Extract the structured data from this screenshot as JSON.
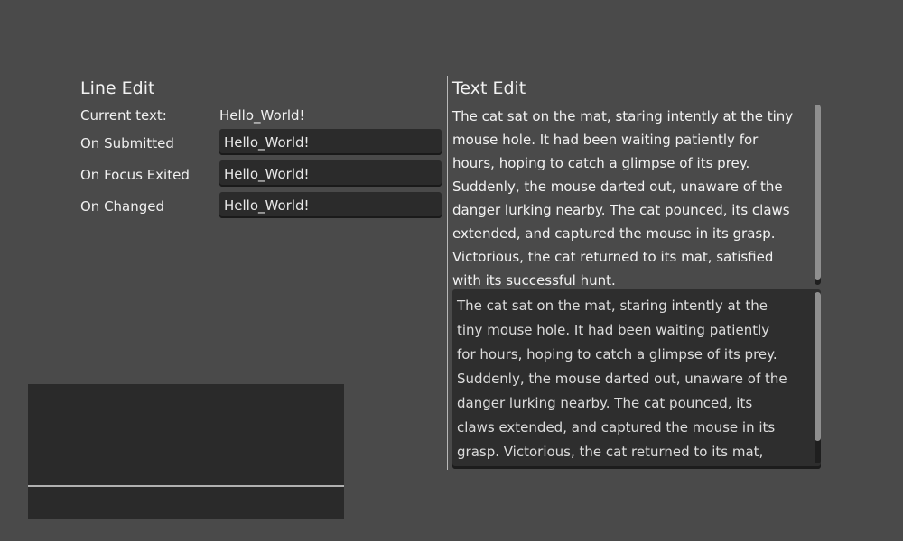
{
  "line_edit": {
    "title": "Line Edit",
    "current_text_label": "Current text:",
    "current_text_value": "Hello_World!",
    "rows": [
      {
        "label": "On Submitted",
        "value": "Hello_World!"
      },
      {
        "label": "On Focus Exited",
        "value": "Hello_World!"
      },
      {
        "label": "On Changed",
        "value": "Hello_World!"
      }
    ]
  },
  "text_edit": {
    "title": "Text Edit",
    "display_text": "The cat sat on the mat, staring intently at the tiny\nmouse hole. It had been waiting patiently for\nhours, hoping to catch a glimpse of its prey.\nSuddenly, the mouse darted out, unaware of the\ndanger lurking nearby. The cat pounced, its claws\nextended, and captured the mouse in its grasp.\nVictorious, the cat returned to its mat, satisfied\nwith its successful hunt.",
    "editor_text": "The cat sat on the mat, staring intently at the\ntiny mouse hole. It had been waiting patiently\nfor hours, hoping to catch a glimpse of its prey.\nSuddenly, the mouse darted out, unaware of the\ndanger lurking nearby. The cat pounced, its\nclaws extended, and captured the mouse in its\ngrasp. Victorious, the cat returned to its mat,"
  },
  "colors": {
    "background": "#4a4a4a",
    "field": "#2b2b2b",
    "panel": "#2a2a2a",
    "scroll_thumb": "#8f8f8f"
  }
}
